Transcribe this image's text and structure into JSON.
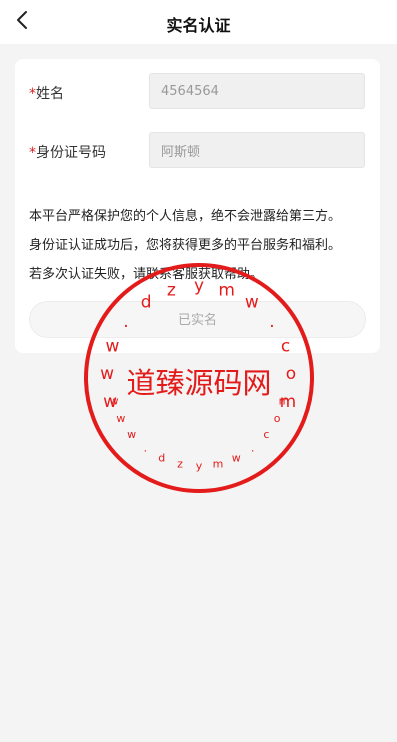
{
  "navbar": {
    "title": "实名认证",
    "back_icon": "chevron-left-icon"
  },
  "form": {
    "required_mark": "*",
    "name_label": "姓名",
    "name_value": "4564564",
    "id_label": "身份证号码",
    "id_value": "阿斯顿"
  },
  "notice": {
    "line1": "本平台严格保护您的个人信息，绝不会泄露给第三方。",
    "line2": "身份证认证成功后，您将获得更多的平台服务和福利。",
    "line3": "若多次认证失败，请联系客服获取帮助。"
  },
  "submit_button": {
    "label": "已实名"
  },
  "watermark": {
    "center_text": "道臻源码网",
    "ring_text": "www.dzymw.com",
    "color": "#e31b1b"
  },
  "colors": {
    "background": "#f4f4f4",
    "card": "#ffffff",
    "required": "#e02020"
  }
}
